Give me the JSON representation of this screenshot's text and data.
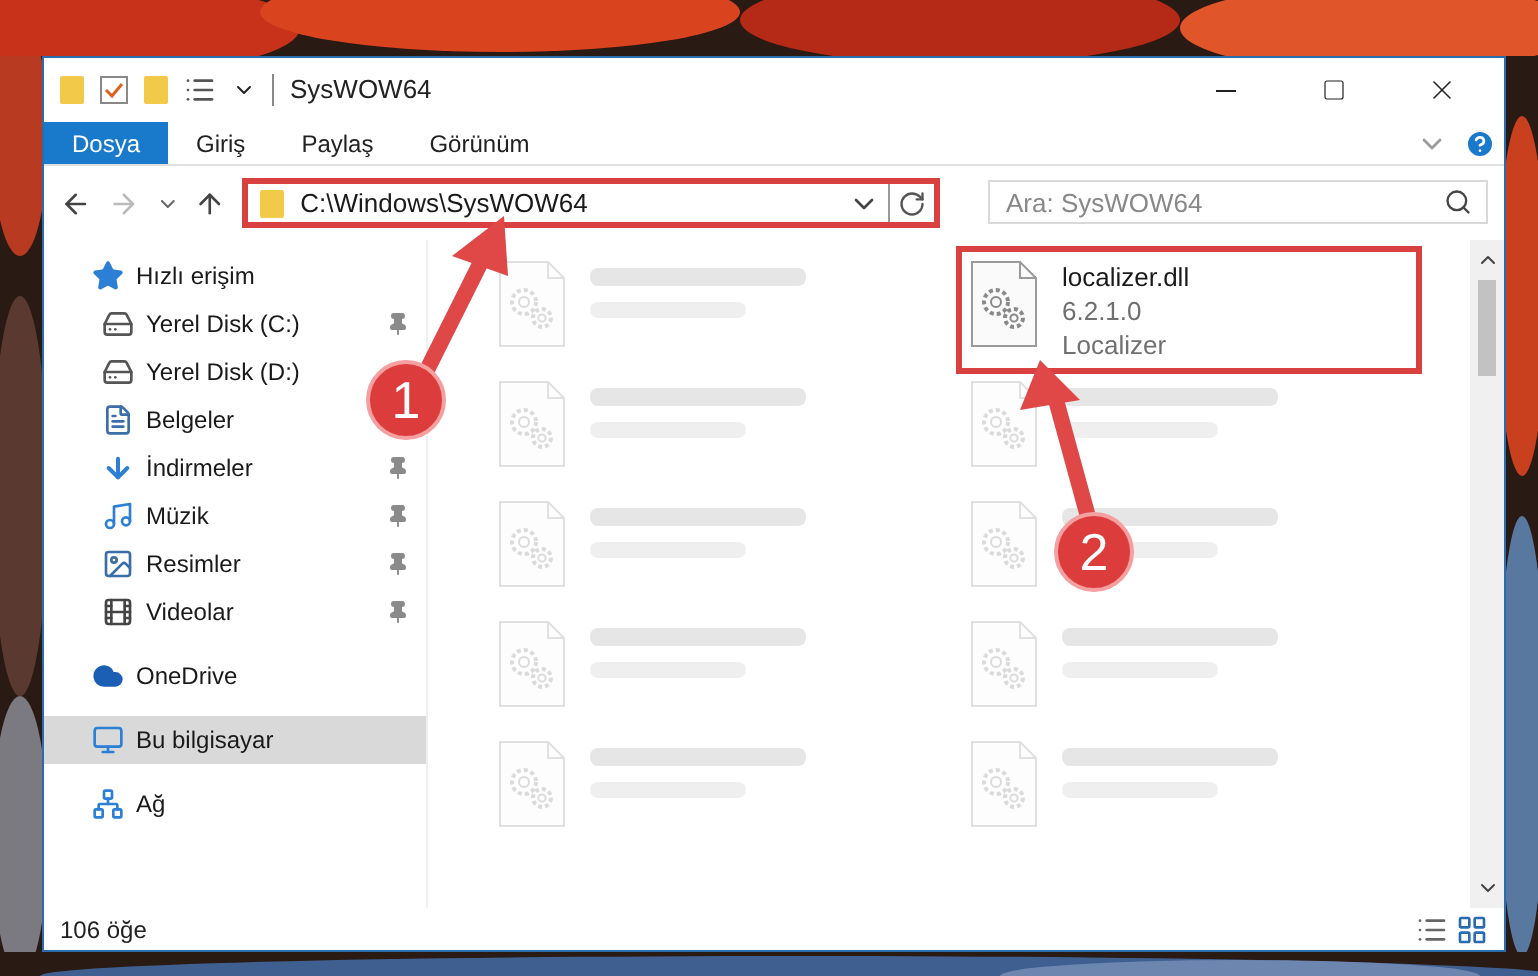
{
  "window": {
    "title": "SysWOW64"
  },
  "ribbon_tabs": [
    {
      "label": "Dosya",
      "selected": true
    },
    {
      "label": "Giriş",
      "selected": false
    },
    {
      "label": "Paylaş",
      "selected": false
    },
    {
      "label": "Görünüm",
      "selected": false
    }
  ],
  "address": {
    "value": "C:\\Windows\\SysWOW64",
    "highlighted": true
  },
  "search": {
    "placeholder": "Ara: SysWOW64"
  },
  "sidebar": {
    "items": [
      {
        "label": "Hızlı erişim",
        "kind": "star",
        "selected": false,
        "children": [
          {
            "label": "Yerel Disk (C:)",
            "kind": "system-drive",
            "pinned": true,
            "selected": false
          },
          {
            "label": "Yerel Disk (D:)",
            "kind": "drive",
            "pinned": false,
            "selected": false
          },
          {
            "label": "Belgeler",
            "kind": "documents",
            "pinned": false,
            "selected": false
          },
          {
            "label": "İndirmeler",
            "kind": "download",
            "pinned": true,
            "selected": false
          },
          {
            "label": "Müzik",
            "kind": "music",
            "pinned": true,
            "selected": false
          },
          {
            "label": "Resimler",
            "kind": "pictures",
            "pinned": true,
            "selected": false
          },
          {
            "label": "Videolar",
            "kind": "videos",
            "pinned": true,
            "selected": false
          }
        ]
      },
      {
        "label": "OneDrive",
        "kind": "cloud",
        "selected": false
      },
      {
        "label": "Bu bilgisayar",
        "kind": "computer",
        "selected": true
      },
      {
        "label": "Ağ",
        "kind": "network",
        "selected": false
      }
    ]
  },
  "files": [
    {
      "kind": "blurred"
    },
    {
      "kind": "file",
      "name": "localizer.dll",
      "details": [
        "6.2.1.0",
        "Localizer"
      ],
      "highlighted": true
    },
    {
      "kind": "blurred"
    },
    {
      "kind": "blurred"
    },
    {
      "kind": "blurred"
    },
    {
      "kind": "blurred"
    },
    {
      "kind": "blurred"
    },
    {
      "kind": "blurred"
    },
    {
      "kind": "blurred"
    },
    {
      "kind": "blurred"
    }
  ],
  "status_bar": {
    "count": "106 öğe"
  },
  "annotations": [
    {
      "label": "1"
    },
    {
      "label": "2"
    }
  ]
}
